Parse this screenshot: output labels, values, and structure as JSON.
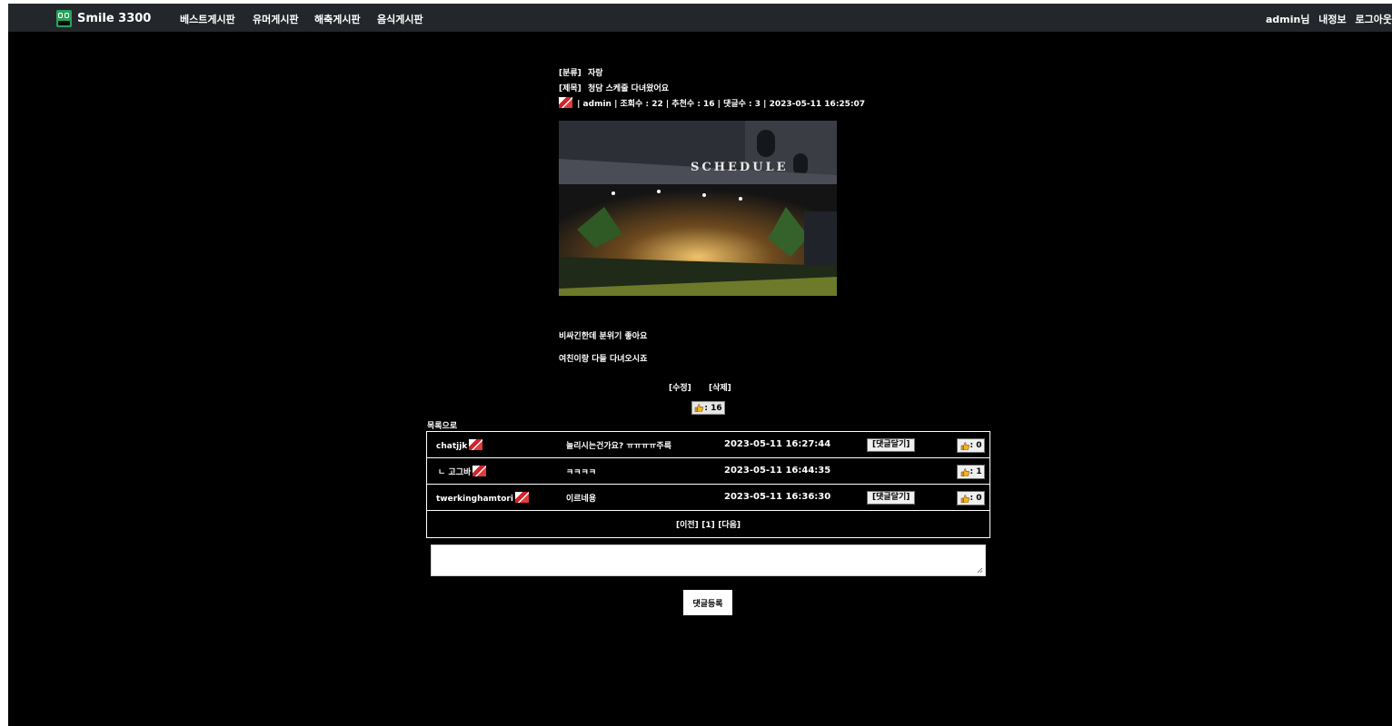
{
  "nav": {
    "logo_text": "Smile 3300",
    "items": [
      {
        "label": "베스트게시판"
      },
      {
        "label": "유머게시판"
      },
      {
        "label": "해축게시판"
      },
      {
        "label": "음식게시판"
      }
    ],
    "user_greeting": "admin님",
    "my_info": "내정보",
    "logout": "로그아웃"
  },
  "post": {
    "category_label": "[분류]",
    "category": "자랑",
    "title_label": "[제목]",
    "title": "청담 스케줄 다녀왔어요",
    "meta": "| admin | 조회수 : 22 | 추천수 : 16 | 댓글수 : 3 | 2023-05-11 16:25:07",
    "image_sign_text": "SCHEDULE",
    "body_lines": [
      "비싸긴한데 분위기 좋아요",
      "여친이랑 다들 다녀오시죠"
    ],
    "edit_label": "[수정]",
    "delete_label": "[삭제]",
    "likes_label": ": 16"
  },
  "list_link": "목록으로",
  "comments": [
    {
      "author": "chatjjk",
      "text": "놀리시는건가요? ㅠㅠㅠㅠ주륵",
      "date": "2023-05-11 16:27:44",
      "reply_label": "[댓글달기]",
      "likes_label": ": 0"
    },
    {
      "author": "ㄴ 고그바",
      "text": "ㅋㅋㅋㅋ",
      "date": "2023-05-11 16:44:35",
      "reply_label": "",
      "likes_label": ": 1"
    },
    {
      "author": "twerkinghamtori",
      "text": "이르네용",
      "date": "2023-05-11 16:36:30",
      "reply_label": "[댓글달기]",
      "likes_label": ": 0"
    }
  ],
  "pagination": {
    "prev": "[이전]",
    "page": "[1]",
    "next": "[다음]"
  },
  "comment_form": {
    "value": "",
    "submit_label": "댓글등록"
  },
  "colors": {
    "background": "#000000",
    "topbar": "#23272b",
    "logo_green": "#27a35a",
    "like_icon": "#f2b32a"
  }
}
